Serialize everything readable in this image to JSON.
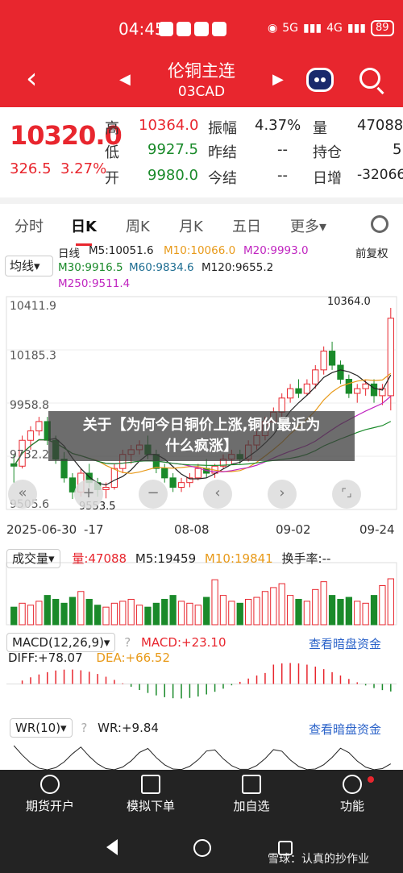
{
  "status": {
    "time": "04:45",
    "network": "5G",
    "network2": "4G",
    "battery": "89"
  },
  "nav": {
    "title": "伦铜主连",
    "code": "03CAD"
  },
  "quote": {
    "price": "10320.0",
    "change": "326.5",
    "change_pct": "3.27%",
    "high_label": "高",
    "high": "10364.0",
    "low_label": "低",
    "low": "9927.5",
    "open_label": "开",
    "open": "9980.0",
    "amp_label": "振幅",
    "amp": "4.37%",
    "prevsettle_label": "昨结",
    "prevsettle": "--",
    "settle_label": "今结",
    "settle": "--",
    "vol_label": "量",
    "vol": "47088",
    "oi_label": "持仓",
    "oi": "5",
    "oi_chg_label": "日增",
    "oi_chg": "-32066"
  },
  "tabs": [
    "分时",
    "日K",
    "周K",
    "月K",
    "五日",
    "更多▾"
  ],
  "kline": {
    "junxian": "均线▾",
    "ma_title": "日线",
    "ma5": "M5:10051.6",
    "ma10": "M10:10066.0",
    "ma20": "M20:9993.0",
    "ma30": "M30:9916.5",
    "ma60": "M60:9834.6",
    "ma120": "M120:9655.2",
    "ma250": "M250:9511.4",
    "adjust": "前复权",
    "y_labels": [
      "10411.9",
      "10185.3",
      "9958.8",
      "9732.2",
      "9505.6"
    ],
    "max_label": "10364.0",
    "min_label": "9553.5",
    "dates": [
      "2025-06-30",
      "-17",
      "08-08",
      "09-02",
      "09-24"
    ]
  },
  "volume": {
    "label": "成交量▾",
    "vol": "量:47088",
    "m5": "M5:19459",
    "m10": "M10:19841",
    "turnover": "换手率:--"
  },
  "macd": {
    "label": "MACD(12,26,9)▾",
    "macd": "MACD:+23.10",
    "link": "查看暗盘资金",
    "diff": "DIFF:+78.07",
    "dea": "DEA:+66.52"
  },
  "wr": {
    "label": "WR(10)▾",
    "wr": "WR:+9.84",
    "link": "查看暗盘资金"
  },
  "banner": {
    "line1": "关于【为何今日铜价上涨,铜价最近为",
    "line2": "什么疯涨】"
  },
  "controls": [
    "«",
    "+",
    "−",
    "‹",
    "›",
    "⌜⌟"
  ],
  "bottom_nav": [
    "期货开户",
    "模拟下单",
    "加自选",
    "功能"
  ],
  "watermark": "雪球：认真的抄作业",
  "colors": {
    "up": "#e8262e",
    "down": "#1a8a2a",
    "header": "#e8262e"
  },
  "chart_data": {
    "type": "candlestick",
    "candles": [
      [
        9700,
        9740,
        9620,
        9690
      ],
      [
        9690,
        9820,
        9680,
        9800
      ],
      [
        9800,
        9860,
        9760,
        9840
      ],
      [
        9840,
        9900,
        9820,
        9880
      ],
      [
        9880,
        9900,
        9780,
        9800
      ],
      [
        9800,
        9820,
        9700,
        9720
      ],
      [
        9720,
        9750,
        9620,
        9640
      ],
      [
        9640,
        9660,
        9550,
        9580
      ],
      [
        9580,
        9680,
        9560,
        9660
      ],
      [
        9660,
        9700,
        9600,
        9620
      ],
      [
        9620,
        9640,
        9560,
        9590
      ],
      [
        9590,
        9620,
        9553,
        9600
      ],
      [
        9600,
        9700,
        9590,
        9680
      ],
      [
        9680,
        9760,
        9660,
        9740
      ],
      [
        9740,
        9780,
        9700,
        9760
      ],
      [
        9760,
        9800,
        9740,
        9780
      ],
      [
        9780,
        9820,
        9720,
        9740
      ],
      [
        9740,
        9760,
        9660,
        9680
      ],
      [
        9680,
        9700,
        9620,
        9640
      ],
      [
        9640,
        9660,
        9580,
        9600
      ],
      [
        9600,
        9640,
        9580,
        9620
      ],
      [
        9620,
        9660,
        9600,
        9640
      ],
      [
        9640,
        9700,
        9630,
        9680
      ],
      [
        9680,
        9720,
        9640,
        9660
      ],
      [
        9660,
        9700,
        9640,
        9690
      ],
      [
        9690,
        9740,
        9680,
        9720
      ],
      [
        9720,
        9760,
        9700,
        9740
      ],
      [
        9740,
        9760,
        9700,
        9720
      ],
      [
        9720,
        9800,
        9710,
        9780
      ],
      [
        9780,
        9840,
        9760,
        9820
      ],
      [
        9820,
        9900,
        9800,
        9880
      ],
      [
        9880,
        9940,
        9860,
        9920
      ],
      [
        9920,
        10000,
        9900,
        9980
      ],
      [
        9980,
        10040,
        9960,
        10020
      ],
      [
        10020,
        10060,
        9980,
        10000
      ],
      [
        10000,
        10060,
        9990,
        10040
      ],
      [
        10040,
        10120,
        10020,
        10100
      ],
      [
        10100,
        10200,
        10080,
        10180
      ],
      [
        10180,
        10220,
        10100,
        10120
      ],
      [
        10120,
        10140,
        10040,
        10060
      ],
      [
        10060,
        10080,
        9980,
        10000
      ],
      [
        10000,
        10040,
        9960,
        10020
      ],
      [
        10020,
        10060,
        9990,
        10040
      ],
      [
        10040,
        10060,
        9960,
        9990
      ],
      [
        9990,
        10040,
        9950,
        10020
      ],
      [
        9990,
        10364,
        9927.5,
        10320
      ]
    ],
    "volumes": [
      18,
      22,
      20,
      24,
      30,
      26,
      22,
      28,
      34,
      26,
      20,
      18,
      22,
      24,
      26,
      20,
      18,
      22,
      26,
      30,
      24,
      22,
      20,
      28,
      46,
      30,
      24,
      22,
      26,
      28,
      34,
      38,
      42,
      30,
      26,
      24,
      36,
      44,
      30,
      26,
      28,
      24,
      22,
      30,
      40,
      47
    ],
    "y_range": [
      9505.6,
      10411.9
    ]
  }
}
